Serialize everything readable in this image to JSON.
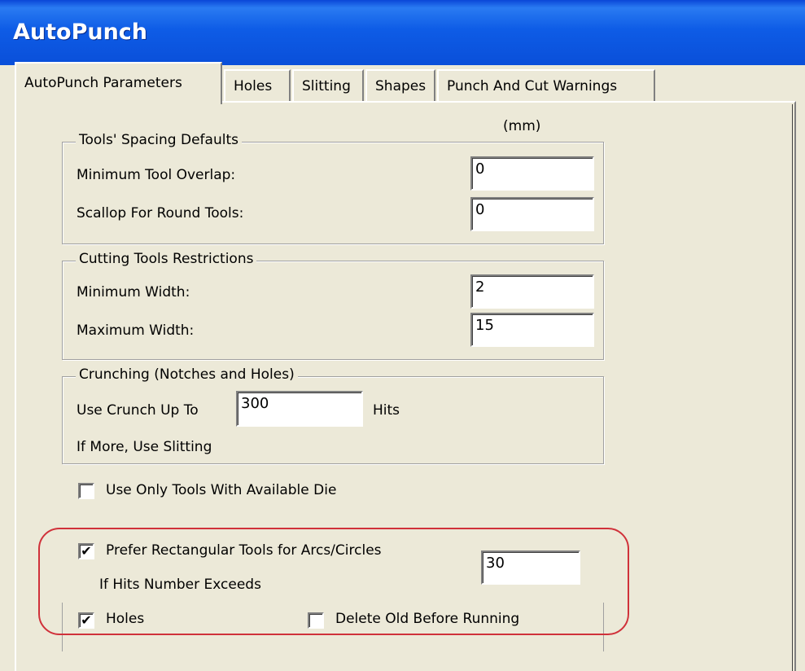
{
  "window": {
    "title": "AutoPunch"
  },
  "tabs": [
    {
      "label": "AutoPunch Parameters",
      "active": true
    },
    {
      "label": "Holes",
      "active": false
    },
    {
      "label": "Slitting",
      "active": false
    },
    {
      "label": "Shapes",
      "active": false
    },
    {
      "label": "Punch And Cut Warnings",
      "active": false
    }
  ],
  "units_label": "(mm)",
  "spacing_group": {
    "title": "Tools' Spacing Defaults",
    "min_overlap_label": "Minimum Tool Overlap:",
    "min_overlap_value": "0",
    "scallop_label": "Scallop For Round Tools:",
    "scallop_value": "0"
  },
  "cutting_group": {
    "title": "Cutting Tools Restrictions",
    "min_width_label": "Minimum Width:",
    "min_width_value": "2",
    "max_width_label": "Maximum Width:",
    "max_width_value": "15"
  },
  "crunching_group": {
    "title": "Crunching (Notches and Holes)",
    "use_crunch_label": "Use Crunch Up To",
    "use_crunch_value": "300",
    "hits_label": "Hits",
    "if_more_label": "If More, Use Slitting"
  },
  "options": {
    "use_only_tools_label": "Use Only Tools With Available Die",
    "use_only_tools_checked": false,
    "prefer_rect_label": "Prefer Rectangular Tools for Arcs/Circles",
    "prefer_rect_checked": true,
    "hits_exceeds_label": "If Hits Number Exceeds",
    "hits_exceeds_value": "30",
    "holes_label": "Holes",
    "holes_checked": true,
    "delete_old_label": "Delete Old Before Running",
    "delete_old_checked": false
  },
  "highlight_color": "#d0313a"
}
